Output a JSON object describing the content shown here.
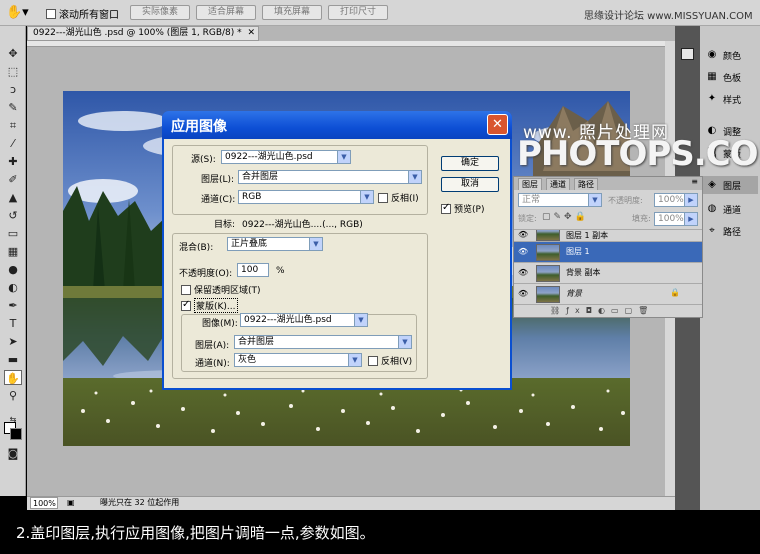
{
  "topbar": {
    "scroll_all_label": "滚动所有窗口",
    "buttons": [
      "实际像素",
      "适合屏幕",
      "填充屏幕",
      "打印尺寸"
    ],
    "brand": "思缘设计论坛 www.MISSYUAN.COM"
  },
  "document": {
    "tab_title": "0922---湖光山色 .psd @ 100% (图层 1, RGB/8) *",
    "zoom": "100%",
    "status": "曝光只在 32 位起作用"
  },
  "right_panel": {
    "items": [
      "颜色",
      "色板",
      "样式",
      "调整",
      "蒙版",
      "图层",
      "通道",
      "路径"
    ]
  },
  "layers_panel": {
    "tabs": [
      "图层",
      "通道",
      "路径"
    ],
    "blend_mode": "正常",
    "opacity_label": "不透明度:",
    "opacity_value": "100%",
    "lock_label": "锁定:",
    "fill_label": "填充:",
    "fill_value": "100%",
    "layers": [
      "图层 1 副本",
      "图层 1",
      "背景 副本",
      "背景"
    ]
  },
  "dialog": {
    "title": "应用图像",
    "source_label": "源(S):",
    "source_value": "0922---湖光山色.psd",
    "layer_label": "图层(L):",
    "layer_value": "合并图层",
    "channel_label": "通道(C):",
    "channel_value": "RGB",
    "invert_label": "反相(I)",
    "target_label": "目标:",
    "target_value": "0922---湖光山色....(..., RGB)",
    "blending_label": "混合(B):",
    "blending_value": "正片叠底",
    "opacity_label": "不透明度(O):",
    "opacity_value": "100",
    "percent": "%",
    "preserve_label": "保留透明区域(T)",
    "mask_label": "蒙版(K)...",
    "image_label": "图像(M):",
    "image_value": "0922---湖光山色.psd",
    "mask_layer_label": "图层(A):",
    "mask_layer_value": "合并图层",
    "mask_channel_label": "通道(N):",
    "mask_channel_value": "灰色",
    "mask_invert_label": "反相(V)",
    "ok": "确定",
    "cancel": "取消",
    "preview": "预览(P)"
  },
  "watermark": {
    "line1": "www. 照片处理网",
    "line2": "PHOTOPS.COM"
  },
  "caption": "2.盖印图层,执行应用图像,把图片调暗一点,参数如图。"
}
